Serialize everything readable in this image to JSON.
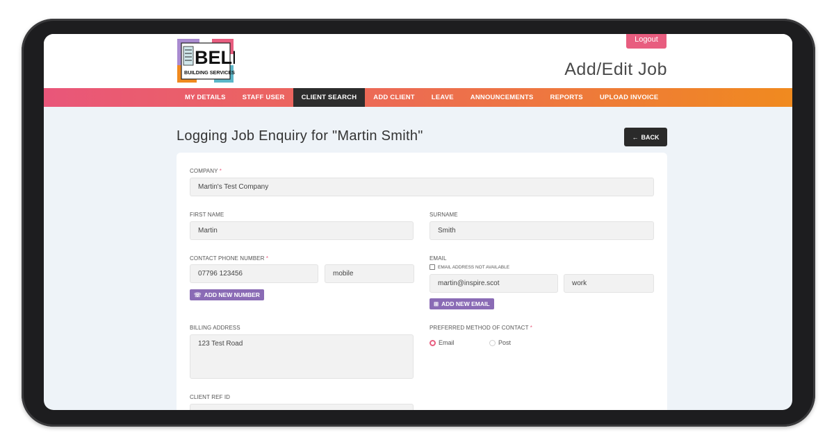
{
  "header": {
    "logo_text": "BELL",
    "logo_subtext": "BUILDING SERVICES",
    "logout_label": "Logout",
    "page_heading": "Add/Edit Job"
  },
  "nav": {
    "items": [
      {
        "label": "MY DETAILS"
      },
      {
        "label": "STAFF USER"
      },
      {
        "label": "CLIENT SEARCH",
        "active": true
      },
      {
        "label": "ADD CLIENT"
      },
      {
        "label": "LEAVE"
      },
      {
        "label": "ANNOUNCEMENTS"
      },
      {
        "label": "REPORTS"
      },
      {
        "label": "UPLOAD INVOICE"
      }
    ]
  },
  "page": {
    "title": "Logging Job Enquiry for \"Martin Smith\"",
    "back_label": "BACK"
  },
  "form": {
    "company": {
      "label": "COMPANY",
      "required": "*",
      "value": "Martin's Test Company"
    },
    "first_name": {
      "label": "FIRST NAME",
      "value": "Martin"
    },
    "surname": {
      "label": "SURNAME",
      "value": "Smith"
    },
    "phone": {
      "label": "CONTACT PHONE NUMBER",
      "required": "*",
      "value": "07796 123456",
      "type": "mobile",
      "add_label": "ADD NEW NUMBER"
    },
    "email": {
      "label": "EMAIL",
      "not_available_label": "EMAIL ADDRESS NOT AVAILABLE",
      "value": "martin@inspire.scot",
      "type": "work",
      "add_label": "ADD NEW EMAIL"
    },
    "billing_address": {
      "label": "BILLING ADDRESS",
      "value": "123 Test Road"
    },
    "preferred_contact": {
      "label": "PREFERRED METHOD OF CONTACT",
      "required": "*",
      "options": [
        {
          "label": "Email",
          "selected": true
        },
        {
          "label": "Post",
          "selected": false
        }
      ]
    },
    "client_ref": {
      "label": "CLIENT REF ID",
      "value": ""
    }
  },
  "colors": {
    "accent": "#e85d7f",
    "purple": "#8a6bb5",
    "nav_start": "#e9567a",
    "nav_end": "#f08a1f",
    "dark": "#2d2d2d"
  }
}
